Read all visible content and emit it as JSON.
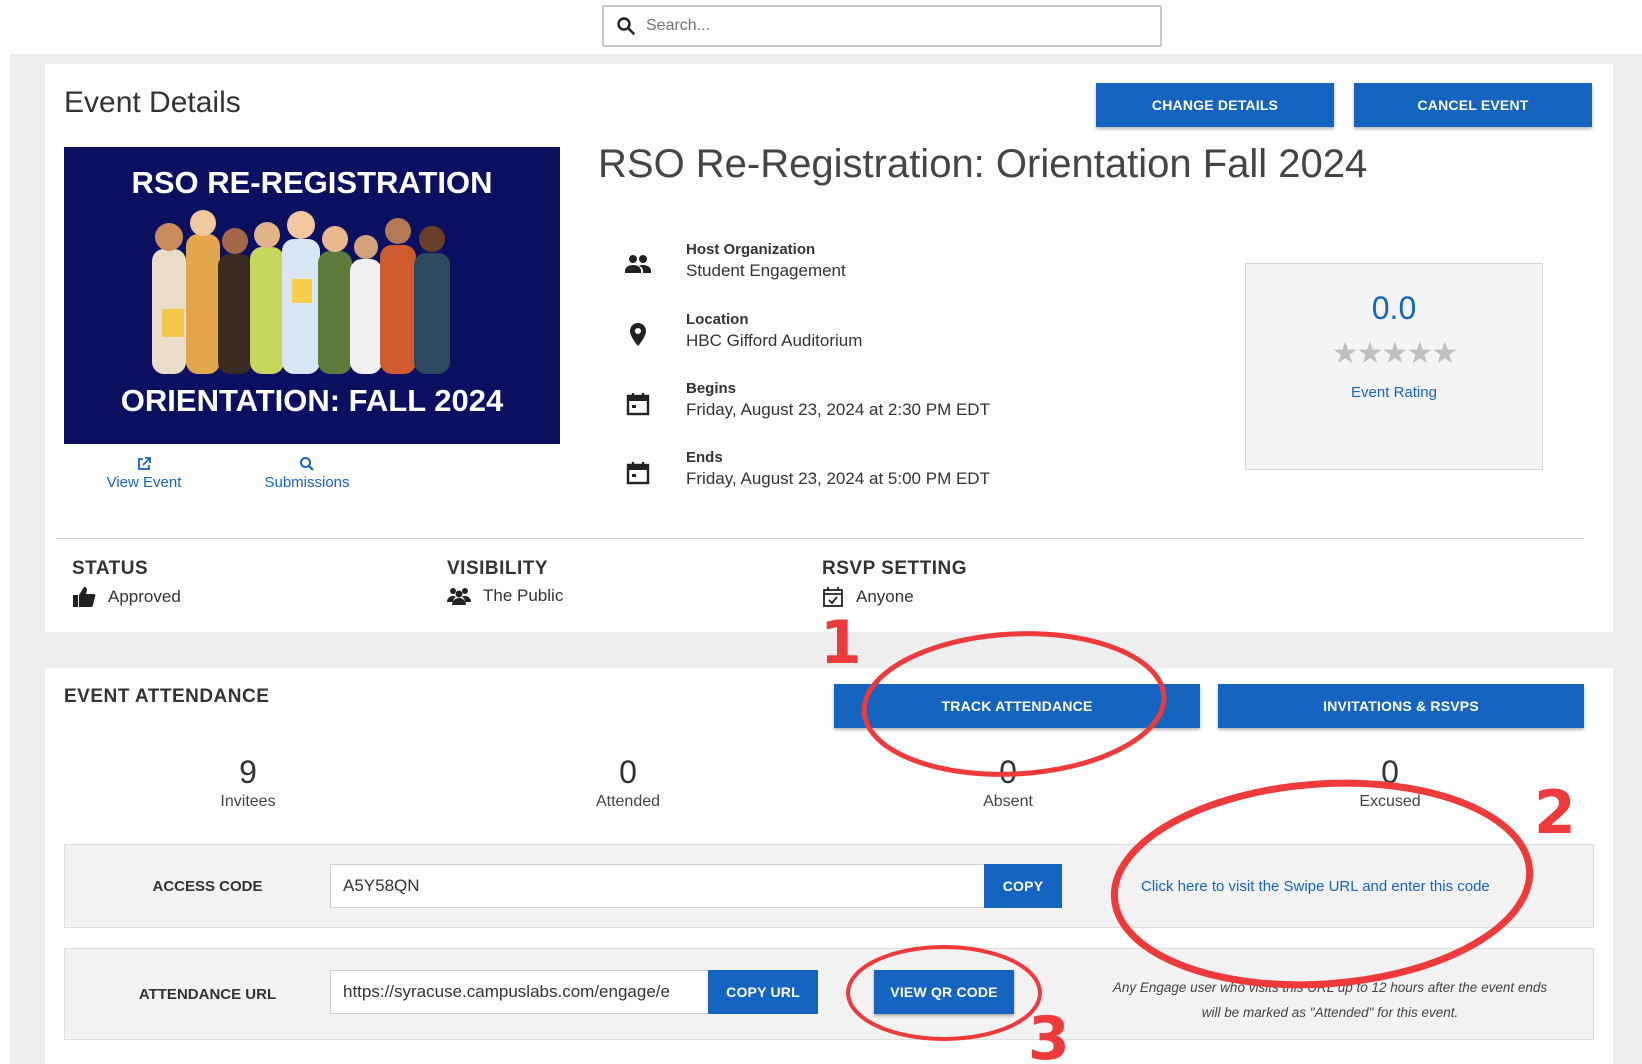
{
  "search": {
    "placeholder": "Search..."
  },
  "page_title": "Event Details",
  "header_buttons": {
    "change_details": "CHANGE DETAILS",
    "cancel_event": "CANCEL EVENT"
  },
  "flyer": {
    "line1": "RSO RE-REGISTRATION",
    "line2": "ORIENTATION: FALL 2024",
    "view_event": "View Event",
    "submissions": "Submissions"
  },
  "event": {
    "title": "RSO Re-Registration: Orientation Fall 2024",
    "host_label": "Host Organization",
    "host_value": "Student Engagement",
    "location_label": "Location",
    "location_value": "HBC Gifford Auditorium",
    "begins_label": "Begins",
    "begins_value": "Friday, August 23, 2024 at 2:30 PM EDT",
    "ends_label": "Ends",
    "ends_value": "Friday, August 23, 2024 at 5:00 PM EDT"
  },
  "rating": {
    "value": "0.0",
    "stars": "★★★★★",
    "label": "Event Rating",
    "filled_stars": 0
  },
  "meta": {
    "status_label": "STATUS",
    "status_value": "Approved",
    "visibility_label": "VISIBILITY",
    "visibility_value": "The Public",
    "rsvp_label": "RSVP SETTING",
    "rsvp_value": "Anyone"
  },
  "attendance": {
    "title": "EVENT ATTENDANCE",
    "track_button": "TRACK ATTENDANCE",
    "invitations_button": "INVITATIONS & RSVPS",
    "stats": [
      {
        "value": "9",
        "label": "Invitees"
      },
      {
        "value": "0",
        "label": "Attended"
      },
      {
        "value": "0",
        "label": "Absent"
      },
      {
        "value": "0",
        "label": "Excused"
      }
    ],
    "access_code_label": "ACCESS CODE",
    "access_code_value": "A5Y58QN",
    "copy_button": "COPY",
    "swipe_link": "Click here to visit the Swipe URL and enter this code",
    "attendance_url_label": "ATTENDANCE URL",
    "attendance_url_value": "https://syracuse.campuslabs.com/engage/e",
    "copy_url_button": "COPY URL",
    "view_qr_button": "VIEW QR CODE",
    "note_line1": "Any Engage user who visits this URL up to 12 hours after the event ends",
    "note_line2": "will be marked as \"Attended\" for this event."
  },
  "annotations": {
    "n1": "1",
    "n2": "2",
    "n3": "3",
    "color": "#ee3a3a"
  },
  "colors": {
    "primary": "#1565c0",
    "flyer_bg": "#0b1060",
    "page_bg": "#eeeeee"
  }
}
